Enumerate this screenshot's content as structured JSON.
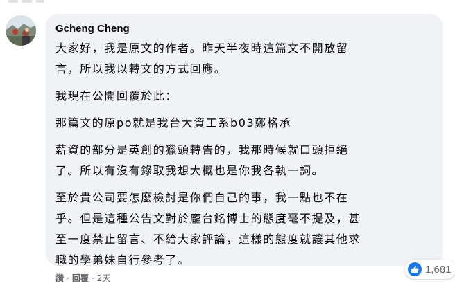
{
  "comment": {
    "author": "Gcheng Cheng",
    "paragraphs": [
      {
        "lines": [
          "大家好，我是原文的作者。昨天半夜時這篇文不開放留",
          "言，所以我以轉文的方式回應。"
        ]
      },
      {
        "lines": [
          "我現在公開回覆於此："
        ]
      },
      {
        "lines": [
          "那篇文的原po就是我台大資工系b03鄭格承"
        ]
      },
      {
        "lines": [
          "薪資的部分是英創的獵頭轉告的，我那時候就口頭拒絕",
          "了。所以有沒有錄取我想大概也是你我各執一詞。"
        ]
      },
      {
        "lines": [
          "至於貴公司要怎麼檢討是你們自己的事，我一點也不在",
          "乎。但是這種公告文對於龐台銘博士的態度毫不提及，甚",
          "至一度禁止留言、不給大家評論，這樣的態度就讓其他求",
          "職的學弟妹自行參考了。"
        ]
      }
    ],
    "reactions": {
      "icon": "thumbs-up-icon",
      "count": "1,681",
      "color": "#1877f2"
    },
    "actions": {
      "like_label": "讚",
      "separator": "·",
      "reply_label": "回覆",
      "time": "2天"
    }
  }
}
